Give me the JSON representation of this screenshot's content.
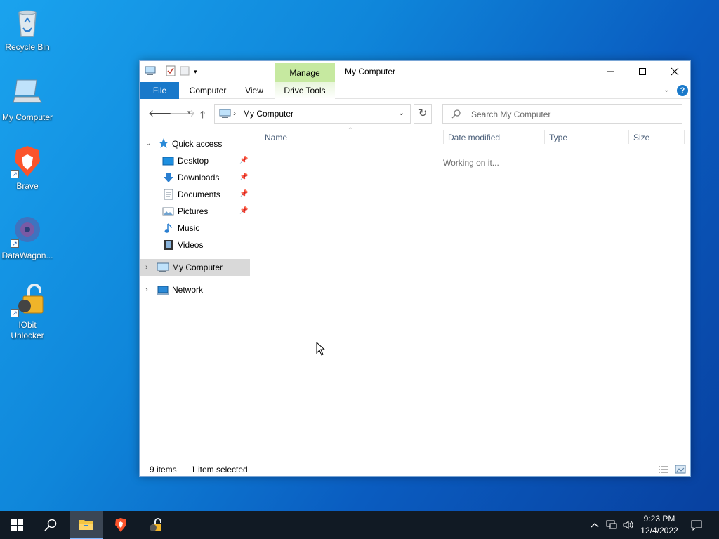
{
  "desktop": {
    "icons": [
      {
        "label": "Recycle Bin",
        "icon": "recycle-bin-icon"
      },
      {
        "label": "My Computer",
        "icon": "computer-icon"
      },
      {
        "label": "Brave",
        "icon": "brave-icon"
      },
      {
        "label": "DataWagon...",
        "icon": "datawagon-icon"
      },
      {
        "label": "IObit Unlocker",
        "icon": "iobit-unlocker-icon"
      }
    ]
  },
  "window": {
    "title": "My Computer",
    "contextual_tab": "Manage",
    "ribbon_tabs": [
      "File",
      "Computer",
      "View",
      "Drive Tools"
    ],
    "address_crumb": "My Computer",
    "search_placeholder": "Search My Computer",
    "controls": {
      "minimize": "—",
      "maximize": "☐",
      "close": "✕"
    }
  },
  "navigation": {
    "quick_access": "Quick access",
    "quick_items": [
      {
        "label": "Desktop",
        "pinned": true
      },
      {
        "label": "Downloads",
        "pinned": true
      },
      {
        "label": "Documents",
        "pinned": true
      },
      {
        "label": "Pictures",
        "pinned": true
      },
      {
        "label": "Music",
        "pinned": false
      },
      {
        "label": "Videos",
        "pinned": false
      }
    ],
    "my_computer": "My Computer",
    "network": "Network"
  },
  "content": {
    "columns": [
      "Name",
      "Date modified",
      "Type",
      "Size"
    ],
    "status_message": "Working on it..."
  },
  "statusbar": {
    "item_count": "9 items",
    "selection": "1 item selected"
  },
  "taskbar": {
    "time": "9:23 PM",
    "date": "12/4/2022"
  },
  "colors": {
    "accent": "#1979ca",
    "manage_tab": "#c6e9a0",
    "selected_nav": "#d9d9d9",
    "taskbar": "#111a24"
  }
}
